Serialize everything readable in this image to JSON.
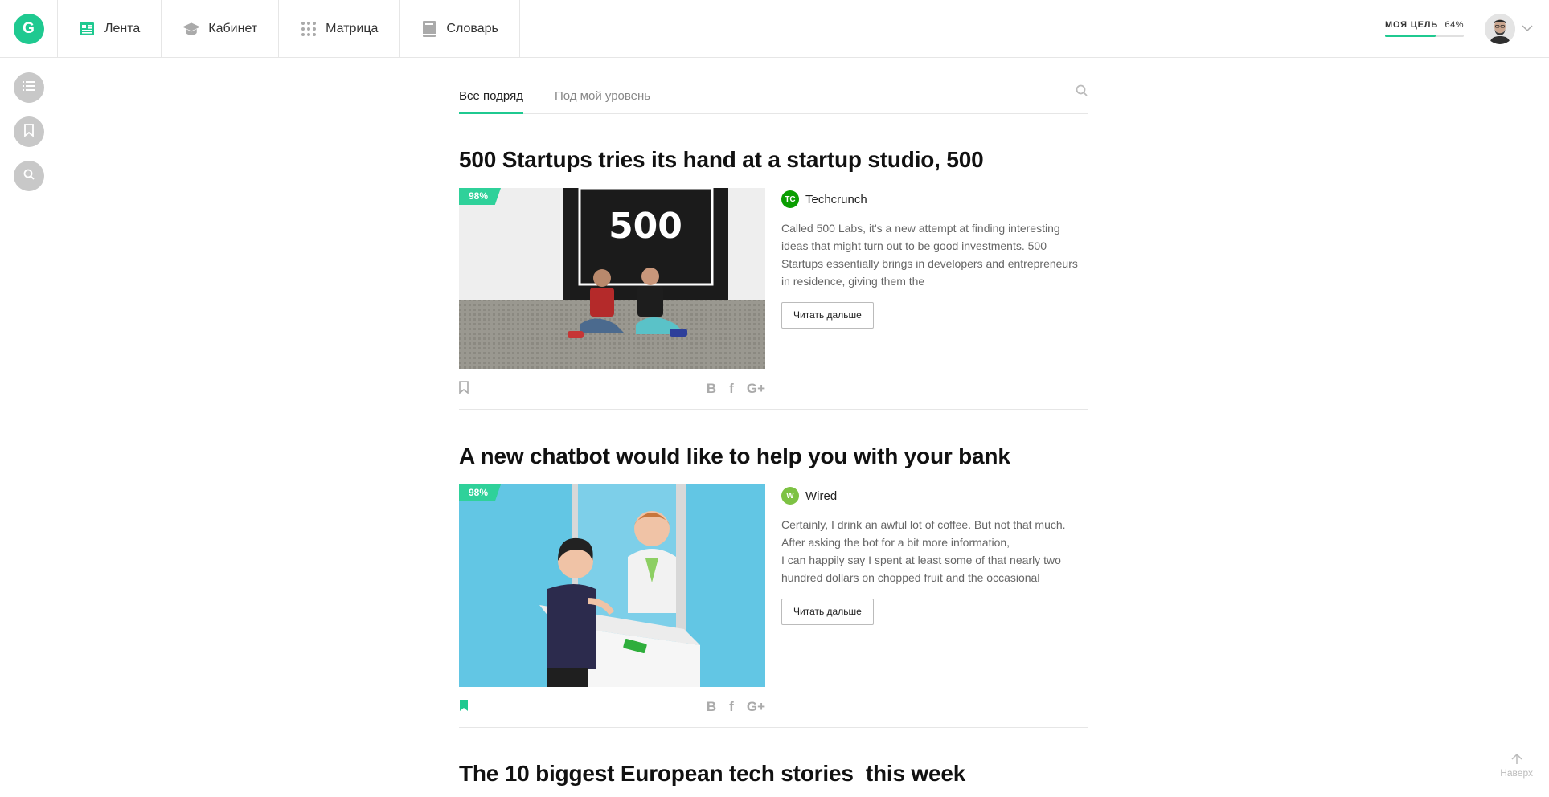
{
  "app": {
    "logo_letter": "G",
    "brand_color": "#1fc990"
  },
  "nav": [
    {
      "label": "Лента",
      "icon": "newspaper-icon",
      "active": true
    },
    {
      "label": "Кабинет",
      "icon": "graduation-cap-icon"
    },
    {
      "label": "Матрица",
      "icon": "grid-dots-icon"
    },
    {
      "label": "Словарь",
      "icon": "book-icon"
    }
  ],
  "goal": {
    "label": "МОЯ ЦЕЛЬ",
    "percent_label": "64%",
    "value": 0.64
  },
  "user": {
    "avatar": "user-avatar",
    "menu_icon": "chevron-down-icon"
  },
  "rail": [
    {
      "icon": "list-icon"
    },
    {
      "icon": "bookmark-icon"
    },
    {
      "icon": "search-icon"
    }
  ],
  "tabs": [
    {
      "label": "Все подряд",
      "active": true
    },
    {
      "label": "Под мой уровень",
      "active": false
    }
  ],
  "articles": [
    {
      "title": "500 Startups tries its hand at a startup studio, 500",
      "match": "98%",
      "source": "Techcrunch",
      "source_icon_text": "TC",
      "source_color": "#0a9e01",
      "excerpt": "Called 500 Labs, it's a new attempt at finding interesting ideas that might turn out to be good investments. 500 Startups essentially brings in developers and entrepreneurs in residence, giving them the",
      "read_more": "Читать дальше",
      "bookmarked": false,
      "shares": [
        "B",
        "f",
        "G+"
      ]
    },
    {
      "title": "A new chatbot would like to help you with your bank",
      "match": "98%",
      "source": "Wired",
      "source_icon_text": "W",
      "source_color": "#7dc243",
      "excerpt_lines": [
        "Certainly, I drink an awful lot of coffee. But not that much.",
        "After asking the bot for a bit more information,",
        "I can happily say I spent at least some of that nearly two",
        "hundred dollars on chopped fruit and the occasional"
      ],
      "read_more": "Читать дальше",
      "bookmarked": true,
      "shares": [
        "B",
        "f",
        "G+"
      ]
    },
    {
      "title": "The 10 biggest European tech stories  this week"
    }
  ],
  "to_top": {
    "label": "Наверх",
    "icon": "arrow-up-icon"
  }
}
